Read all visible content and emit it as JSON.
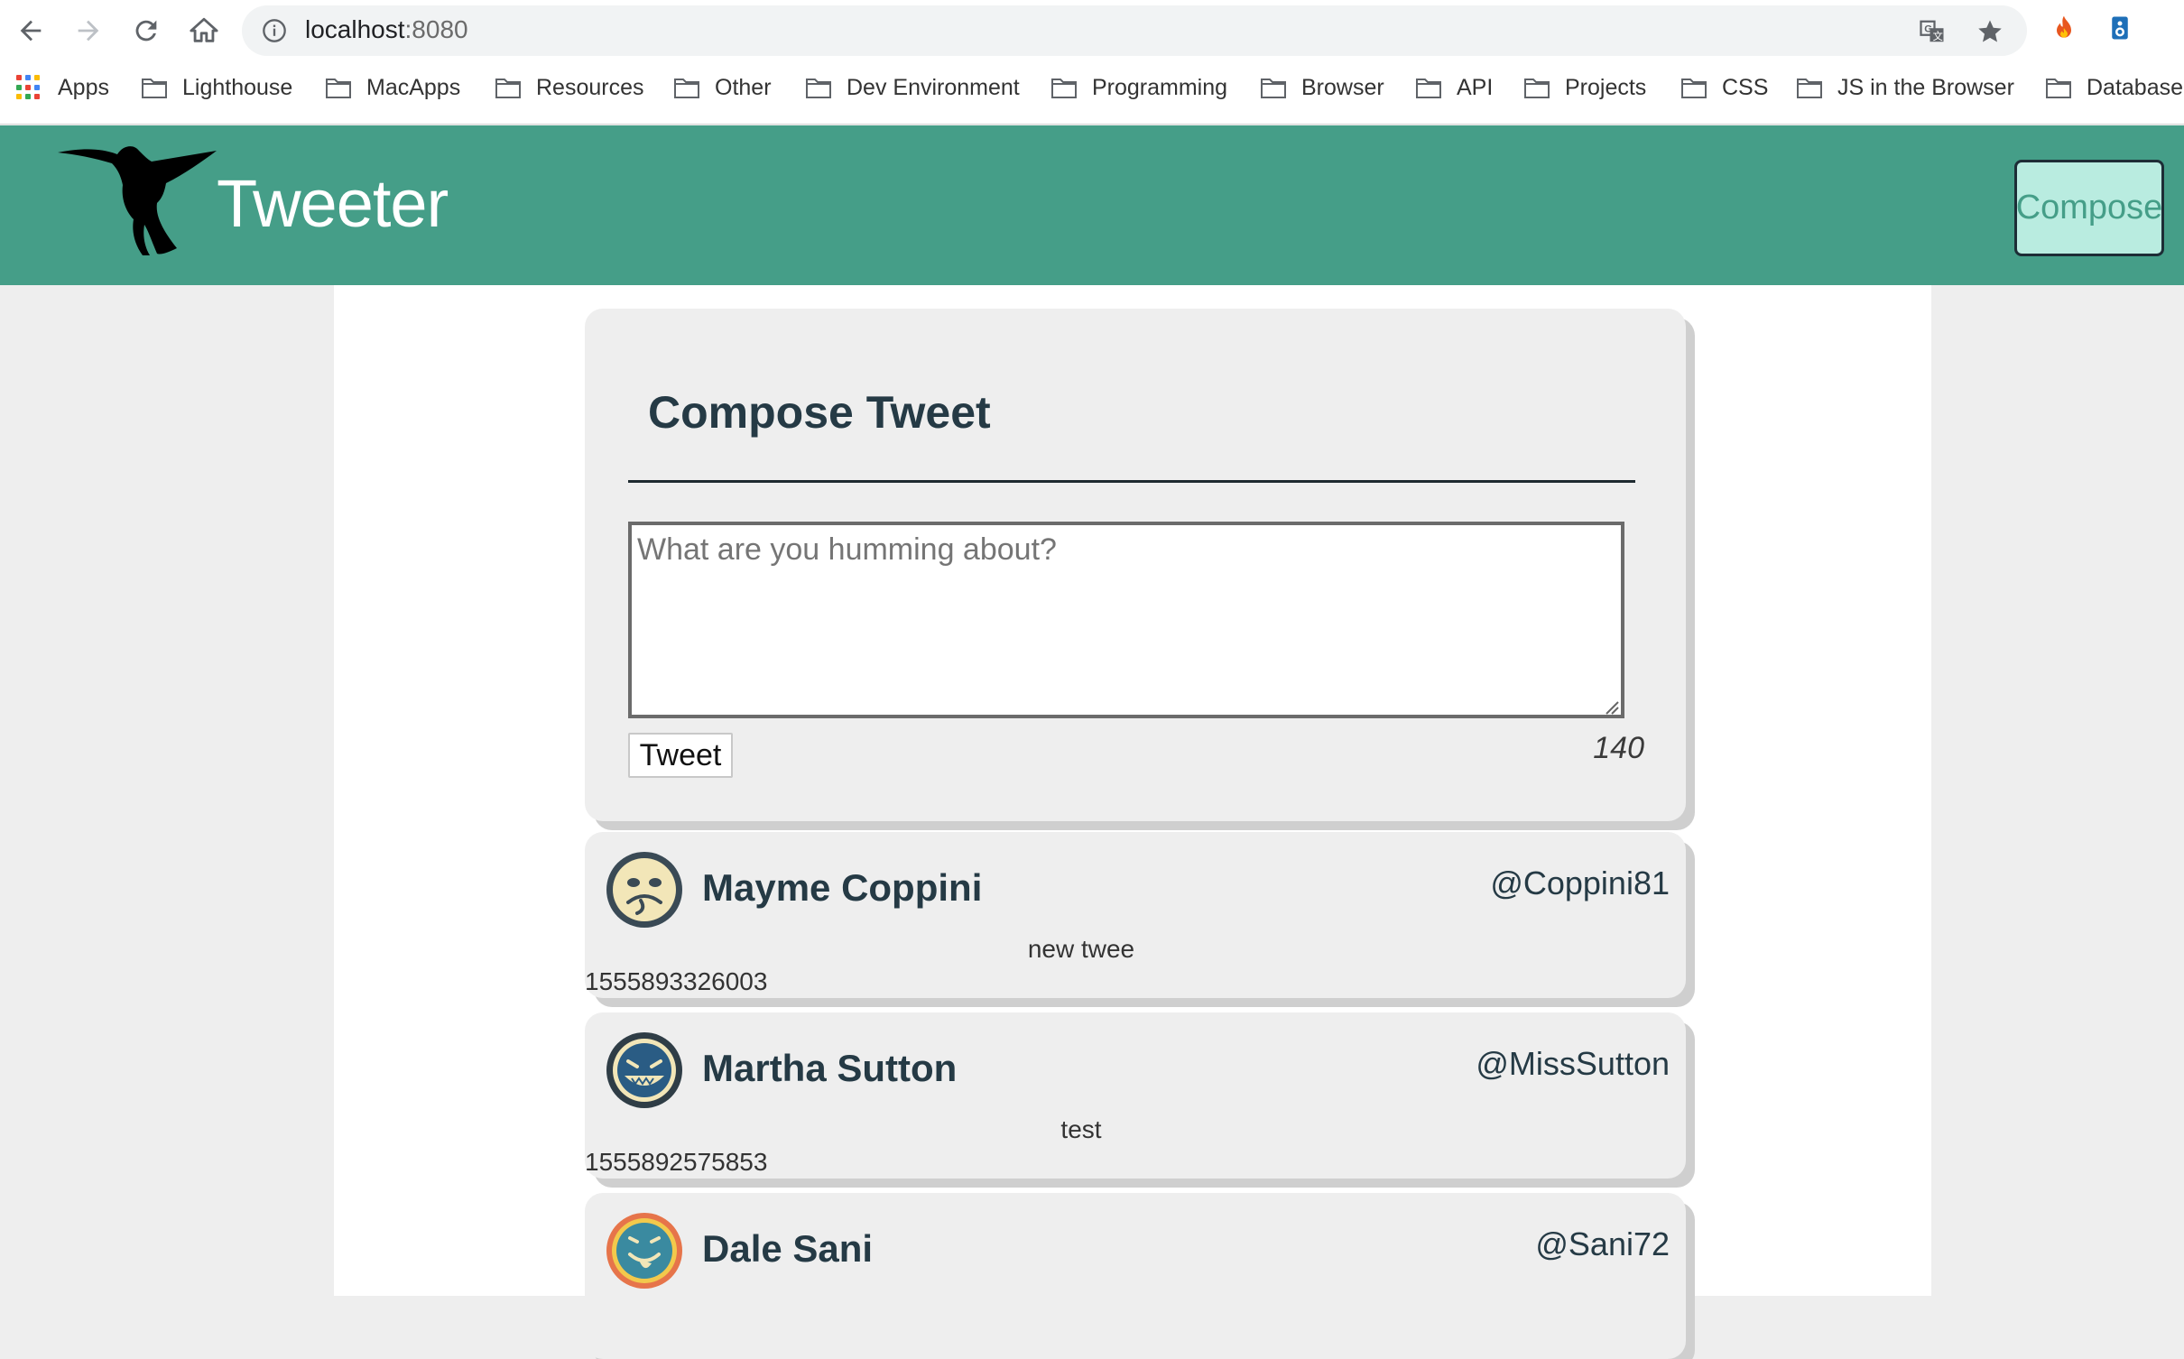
{
  "browser": {
    "url_host": "localhost",
    "url_port": ":8080",
    "bookmarks": [
      {
        "label": "Apps",
        "icon": "apps-grid-icon"
      },
      {
        "label": "Lighthouse",
        "icon": "folder-icon"
      },
      {
        "label": "MacApps",
        "icon": "folder-icon"
      },
      {
        "label": "Resources",
        "icon": "folder-icon"
      },
      {
        "label": "Other",
        "icon": "folder-icon"
      },
      {
        "label": "Dev Environment",
        "icon": "folder-icon"
      },
      {
        "label": "Programming",
        "icon": "folder-icon"
      },
      {
        "label": "Browser",
        "icon": "folder-icon"
      },
      {
        "label": "API",
        "icon": "folder-icon"
      },
      {
        "label": "Projects",
        "icon": "folder-icon"
      },
      {
        "label": "CSS",
        "icon": "folder-icon"
      },
      {
        "label": "JS in the Browser",
        "icon": "folder-icon"
      },
      {
        "label": "Database",
        "icon": "folder-icon"
      }
    ]
  },
  "header": {
    "brand": "Tweeter",
    "compose_label": "Compose",
    "accent_color": "#459e88"
  },
  "compose": {
    "title": "Compose Tweet",
    "placeholder": "What are you humming about?",
    "tweet_button": "Tweet",
    "counter": "140"
  },
  "tweets": [
    {
      "name": "Mayme Coppini",
      "handle": "@Coppini81",
      "text": "new twee",
      "timestamp": "1555893326003",
      "avatar_icon": "face-avatar-icon"
    },
    {
      "name": "Martha Sutton",
      "handle": "@MissSutton",
      "text": "test",
      "timestamp": "1555892575853",
      "avatar_icon": "grin-avatar-icon"
    },
    {
      "name": "Dale Sani",
      "handle": "@Sani72",
      "text": "",
      "timestamp": "",
      "avatar_icon": "tongue-avatar-icon"
    }
  ]
}
